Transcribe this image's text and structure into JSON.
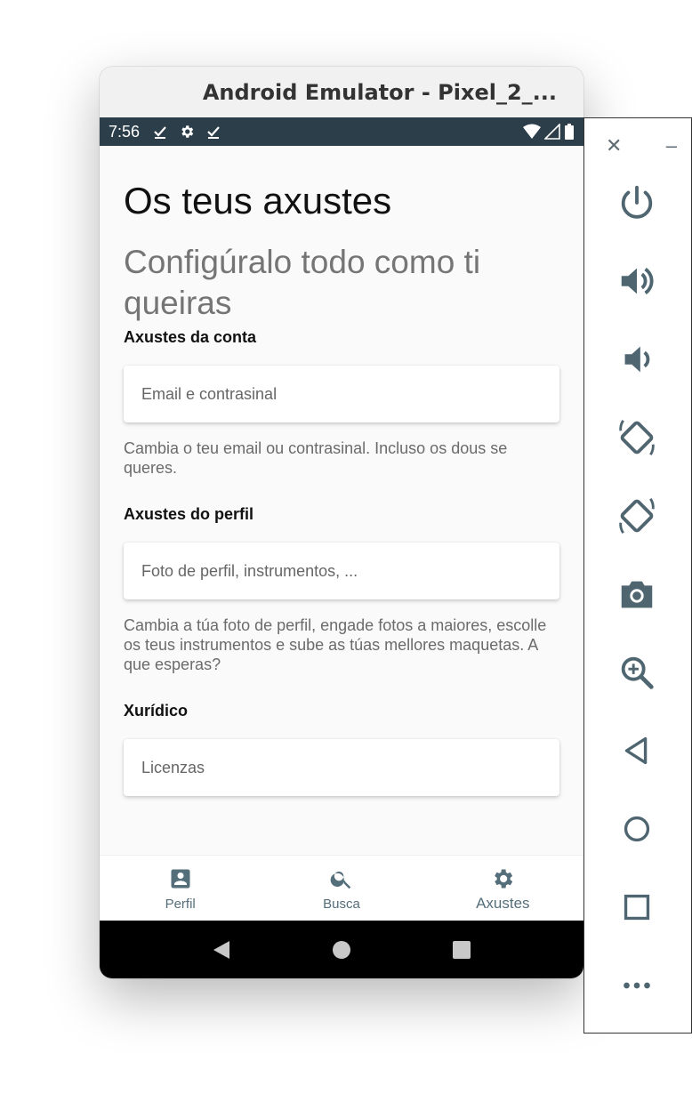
{
  "window": {
    "title": "Android Emulator - Pixel_2_..."
  },
  "status_bar": {
    "time": "7:56"
  },
  "page": {
    "title": "Os teus axustes",
    "subtitle": "Configúralo todo como ti queiras"
  },
  "sections": [
    {
      "title": "Axustes da conta",
      "card": "Email e contrasinal",
      "description": "Cambia o teu email ou contrasinal. Incluso os dous se queres."
    },
    {
      "title": "Axustes do perfil",
      "card": "Foto de perfil, instrumentos, ...",
      "description": "Cambia a túa foto de perfil, engade fotos a maiores, escolle os teus instrumentos e sube as túas mellores maquetas. A que esperas?"
    },
    {
      "title": "Xurídico",
      "card": "Licenzas"
    }
  ],
  "bottom_nav": {
    "items": [
      {
        "label": "Perfil",
        "icon": "account-box-icon",
        "active": false
      },
      {
        "label": "Busca",
        "icon": "search-icon",
        "active": false
      },
      {
        "label": "Axustes",
        "icon": "gear-icon",
        "active": true
      }
    ]
  },
  "side_panel": {
    "buttons": [
      "close-icon",
      "minimize-icon",
      "power-icon",
      "volume-up-icon",
      "volume-down-icon",
      "rotate-left-icon",
      "rotate-right-icon",
      "camera-icon",
      "zoom-in-icon",
      "back-icon",
      "home-icon",
      "overview-icon",
      "more-icon"
    ]
  },
  "colors": {
    "status_bar": "#2c3e4a",
    "accent": "#546e7a",
    "emulator_icons": "#4f6570"
  }
}
